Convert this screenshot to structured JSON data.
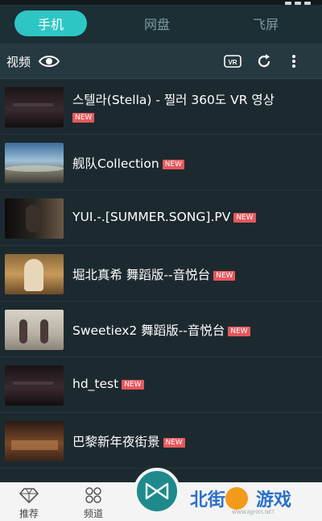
{
  "tabs": [
    {
      "label": "手机",
      "active": true
    },
    {
      "label": "网盘",
      "active": false
    },
    {
      "label": "飞屏",
      "active": false
    }
  ],
  "toolbar": {
    "title": "视频",
    "icons": [
      "eye-icon",
      "vr-icon",
      "refresh-icon",
      "more-icon"
    ],
    "vr_label": "VR"
  },
  "videos": [
    {
      "title": "스텔라(Stella) - 찔러 360도 VR 영상",
      "badge": "NEW",
      "thumb": "dark-screen"
    },
    {
      "title": "舰队Collection",
      "badge": "NEW",
      "thumb": "panorama-sky"
    },
    {
      "title": "YUI.-.[SUMMER.SONG].PV",
      "badge": "NEW",
      "thumb": "dark-portrait"
    },
    {
      "title": "堀北真希 舞蹈版--音悦台",
      "badge": "NEW",
      "thumb": "warm-portrait"
    },
    {
      "title": "Sweetiex2 舞蹈版--音悦台",
      "badge": "NEW",
      "thumb": "dancers"
    },
    {
      "title": "hd_test",
      "badge": "NEW",
      "thumb": "dark-screen"
    },
    {
      "title": "巴黎新年夜街景",
      "badge": "NEW",
      "thumb": "street-night"
    }
  ],
  "bottom_nav": [
    {
      "label": "推荐",
      "icon": "diamond-icon"
    },
    {
      "label": "频道",
      "icon": "grid-icon"
    }
  ],
  "watermark": {
    "text_a": "北街",
    "text_b": "游戏",
    "url": "WWW.BJJHXS.NET"
  },
  "colors": {
    "accent": "#2ec6c4",
    "badge": "#e5585c",
    "background": "#1c2a30"
  }
}
